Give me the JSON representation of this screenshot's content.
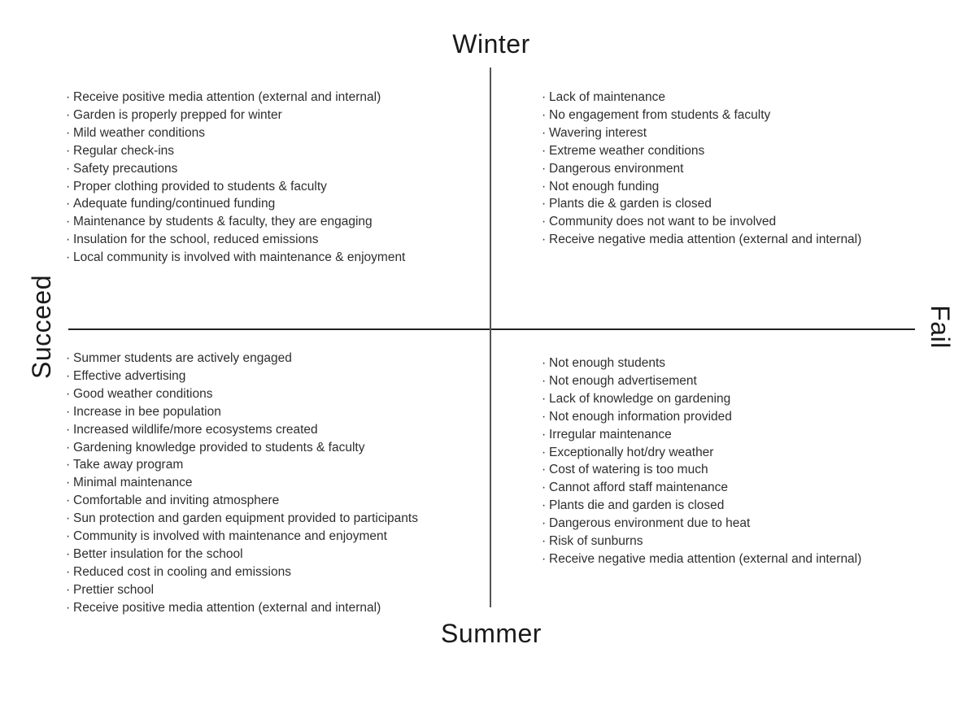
{
  "axes": {
    "top": "Winter",
    "bottom": "Summer",
    "left": "Succeed",
    "right": "Fail"
  },
  "bullet": "·",
  "quadrants": {
    "winter_succeed": [
      "Receive positive media attention (external and internal)",
      "Garden is properly prepped for winter",
      "Mild weather conditions",
      "Regular check-ins",
      "Safety precautions",
      "Proper clothing provided to students & faculty",
      "Adequate funding/continued funding",
      "Maintenance by students & faculty, they are engaging",
      "Insulation for the school, reduced emissions",
      "Local community is involved with maintenance & enjoyment"
    ],
    "winter_fail": [
      "Lack of maintenance",
      "No engagement from students & faculty",
      "Wavering interest",
      "Extreme weather conditions",
      "Dangerous environment",
      "Not enough funding",
      "Plants die & garden is closed",
      "Community does not want to be involved",
      "Receive negative media attention (external and internal)"
    ],
    "summer_succeed": [
      "Summer students are actively engaged",
      "Effective advertising",
      "Good weather conditions",
      "Increase in bee population",
      "Increased wildlife/more ecosystems created",
      "Gardening knowledge provided to students & faculty",
      "Take away program",
      "Minimal maintenance",
      "Comfortable and inviting atmosphere",
      "Sun protection and garden equipment provided to participants",
      "Community is involved with maintenance and enjoyment",
      "Better insulation for the school",
      "Reduced cost in cooling and emissions",
      "Prettier school",
      "Receive positive media attention (external and internal)"
    ],
    "summer_fail": [
      "Not enough students",
      "Not enough advertisement",
      "Lack of knowledge on gardening",
      "Not enough information provided",
      "Irregular maintenance",
      "Exceptionally hot/dry weather",
      "Cost of watering is too much",
      "Cannot afford staff maintenance",
      "Plants die and garden is closed",
      "Dangerous environment due to heat",
      "Risk of sunburns",
      "Receive negative media attention (external and internal)"
    ]
  }
}
